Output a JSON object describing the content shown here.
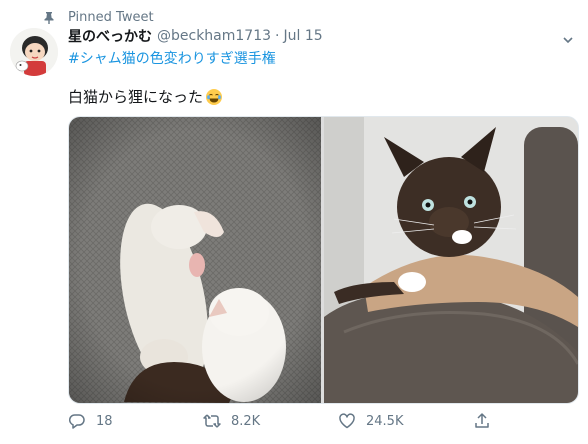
{
  "pinned": {
    "label": "Pinned Tweet"
  },
  "tweet": {
    "display_name": "星のべっかむ",
    "handle": "@beckham1713",
    "separator": "·",
    "date": "Jul 15",
    "hashtag": "#シャム猫の色変わりすぎ選手権",
    "text": "白猫から狸になった",
    "emoji": "joy-face"
  },
  "actions": {
    "reply_count": "18",
    "retweet_count": "8.2K",
    "like_count": "24.5K"
  },
  "icons": [
    "pin-icon",
    "caret-down-icon",
    "reply-icon",
    "retweet-icon",
    "like-icon",
    "share-icon"
  ],
  "colors": {
    "link": "#1b95e0",
    "secondary": "#657786",
    "text": "#14171a"
  }
}
